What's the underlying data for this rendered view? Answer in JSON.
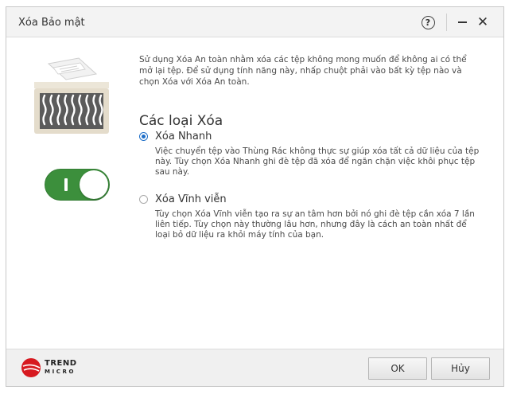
{
  "window": {
    "title": "Xóa Bảo mật"
  },
  "titlebar": {
    "help_icon": "help-icon",
    "minimize_icon": "minimize-icon",
    "close_icon": "close-icon"
  },
  "intro": "Sử dụng Xóa An toàn nhằm xóa các tệp không mong muốn để không ai có thể mở lại tệp. Để sử dụng tính năng này, nhấp chuột phải vào bất kỳ tệp nào và chọn Xóa với Xóa An toàn.",
  "toggle": {
    "state": "on",
    "color": "#3c8f3c"
  },
  "section_title": "Các loại Xóa",
  "options": [
    {
      "label": "Xóa Nhanh",
      "selected": true,
      "description": "Việc chuyển tệp vào Thùng Rác không thực sự giúp xóa tất cả dữ liệu của tệp này. Tùy chọn Xóa Nhanh ghi đè tệp đã xóa để ngăn chặn việc khôi phục tệp sau này."
    },
    {
      "label": "Xóa Vĩnh viễn",
      "selected": false,
      "description": "Tùy chọn Xóa Vĩnh viễn tạo ra sự an tâm hơn bởi nó ghi đè tệp cần xóa 7 lần liên tiếp. Tùy chọn này thường lâu hơn, nhưng đây là cách an toàn nhất để loại bỏ dữ liệu ra khỏi máy tính của bạn."
    }
  ],
  "footer": {
    "logo_line1": "TREND",
    "logo_line2": "MICRO",
    "ok_label": "OK",
    "cancel_label": "Hủy"
  },
  "colors": {
    "accent": "#1e6ec8",
    "brand_red": "#d71920"
  }
}
